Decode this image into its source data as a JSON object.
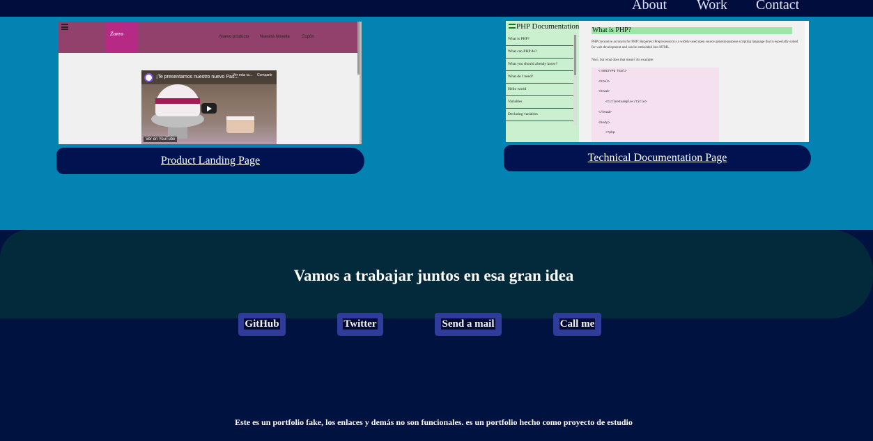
{
  "nav": {
    "about": "About",
    "work": "Work",
    "contact": "Contact"
  },
  "projects": [
    {
      "caption": "Product Landing Page",
      "preview": {
        "nav_items": [
          "Nuevo producto",
          "Nuestra Novella",
          "Cupón"
        ],
        "logo_text": "Zorro",
        "video_title": "¡Te presentamos nuestro nuevo Pas...",
        "video_later": "Ver más ta...",
        "video_share": "Compartir",
        "video_watch_on": "Ver en YouTube"
      }
    },
    {
      "caption": "Technical Documentation Page",
      "preview": {
        "nav_title": "PHP Documentation",
        "nav_items": [
          "What is PHP?",
          "What can PHP do?",
          "What you should already know?",
          "What do I need?",
          "Hello world",
          "Variables",
          "Declaring variables"
        ],
        "heading": "What is PHP?",
        "paragraph": "PHP (recursive acronym for PHP: Hypertext Preprocessor) is a widely-used open source general-purpose scripting language that is especially suited for web development and can be embedded into HTML.",
        "paragraph2": "Nice, but what does that mean? An example:",
        "code_lines": [
          "<!DOCTYPE html>",
          "<html>",
          "<head>",
          "<title>Example</title>",
          "</head>",
          "<body>",
          "<?php"
        ]
      }
    }
  ],
  "cta": {
    "title": "Vamos a trabajar juntos en esa gran idea"
  },
  "social": {
    "github": "GitHub",
    "twitter": "Twitter",
    "mail": "Send a mail",
    "call": "Call me"
  },
  "footer": {
    "note": "Este es un portfolio fake, los enlaces y demás no son funcionales. es un portfolio hecho como proyecto de estudio"
  },
  "colors": {
    "nav_bg": "#000d3d",
    "work_bg": "#0283b1",
    "caption_bg": "#001350",
    "cta_bg": "#022a3a",
    "page_bg": "#001240",
    "social_bg": "#2f3c99"
  }
}
